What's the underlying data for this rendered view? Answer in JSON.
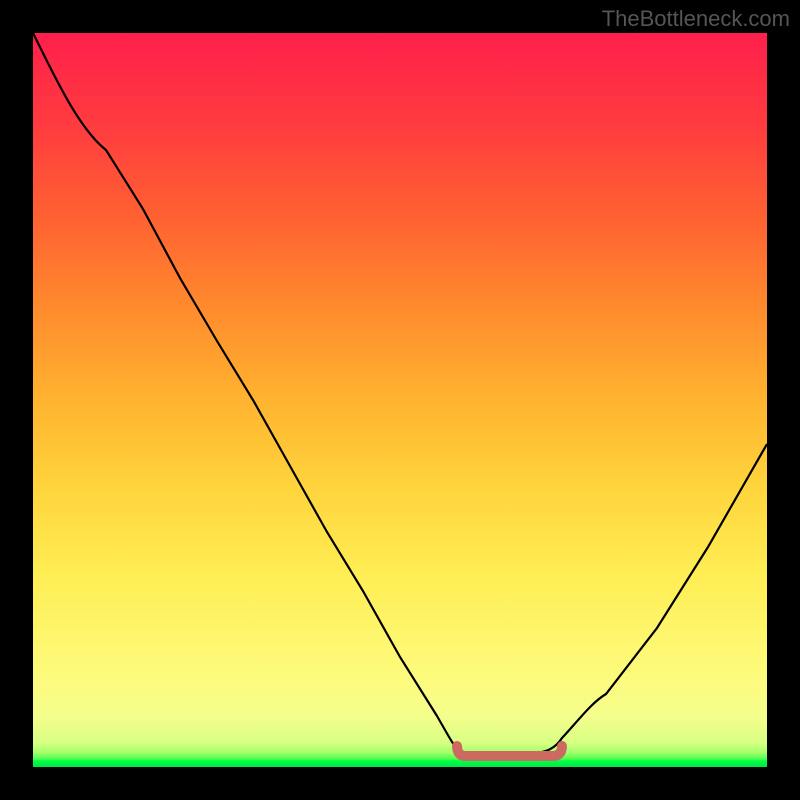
{
  "watermark": "TheBottleneck.com",
  "chart_data": {
    "type": "line",
    "title": "",
    "xlabel": "",
    "ylabel": "",
    "xlim": [
      0,
      1
    ],
    "ylim": [
      0,
      1
    ],
    "series": [
      {
        "name": "bottleneck-curve",
        "x": [
          0.0,
          0.05,
          0.1,
          0.15,
          0.2,
          0.25,
          0.3,
          0.35,
          0.4,
          0.45,
          0.5,
          0.55,
          0.58,
          0.62,
          0.68,
          0.72,
          0.78,
          0.85,
          0.92,
          1.0
        ],
        "y": [
          1.0,
          0.93,
          0.84,
          0.76,
          0.67,
          0.58,
          0.5,
          0.41,
          0.32,
          0.24,
          0.15,
          0.07,
          0.03,
          0.02,
          0.02,
          0.04,
          0.1,
          0.19,
          0.3,
          0.44
        ],
        "color": "#000000"
      }
    ],
    "annotations": [
      {
        "name": "optimal-flat-region",
        "x_range": [
          0.58,
          0.72
        ],
        "y": 0.02,
        "color": "#cc6a61"
      }
    ],
    "background_gradient": {
      "top": "#ff1f4b",
      "middle": "#ffee55",
      "bottom": "#00e840"
    }
  }
}
